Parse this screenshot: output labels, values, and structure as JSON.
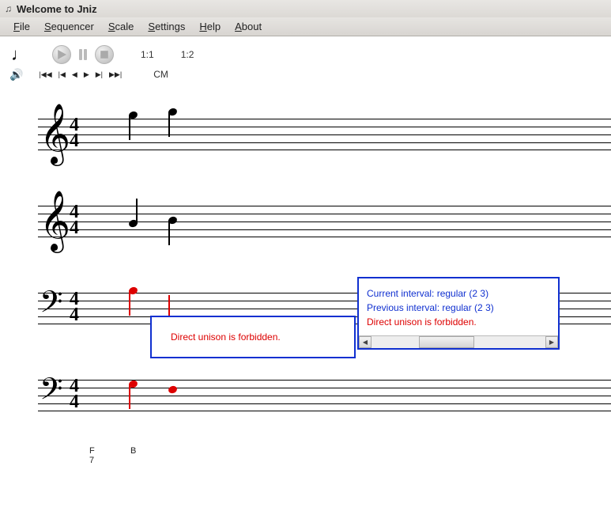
{
  "titlebar": {
    "title": "Welcome to Jniz"
  },
  "menu": {
    "file": "File",
    "sequencer": "Sequencer",
    "scale": "Scale",
    "settings": "Settings",
    "help": "Help",
    "about": "About"
  },
  "toolbar": {
    "pos1": "1:1",
    "pos2": "1:2"
  },
  "subtoolbar": {
    "key": "CM"
  },
  "staves": {
    "time_num": "4",
    "time_den": "4"
  },
  "tooltip1": {
    "text": "Direct unison is forbidden."
  },
  "tooltip2": {
    "line1": "Current interval: regular (2 3)",
    "line2": "Previous interval: regular (2 3)",
    "line3": "Direct unison is forbidden."
  },
  "chords": {
    "c1_top": "F",
    "c1_bot": "7",
    "c2": "B"
  },
  "icons": {
    "app": "app-icon",
    "note": "quarter-note-icon",
    "play": "play-icon",
    "pause": "pause-icon",
    "stop": "stop-icon",
    "speaker": "speaker-icon",
    "first": "skip-first-icon",
    "prev": "prev-icon",
    "back": "back-icon",
    "fwd": "forward-icon",
    "next": "next-icon",
    "last": "skip-last-icon"
  }
}
